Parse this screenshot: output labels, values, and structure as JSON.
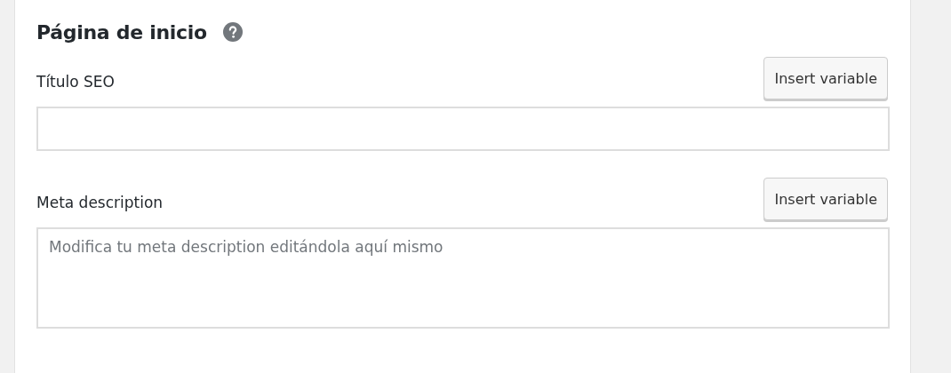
{
  "section": {
    "title": "Página de inicio"
  },
  "fields": [
    {
      "kind": "input",
      "label": "Título SEO",
      "button": "Insert variable"
    },
    {
      "kind": "textarea",
      "label": "Meta description",
      "button": "Insert variable",
      "placeholder": "Modifica tu meta description editándola aquí mismo"
    }
  ]
}
